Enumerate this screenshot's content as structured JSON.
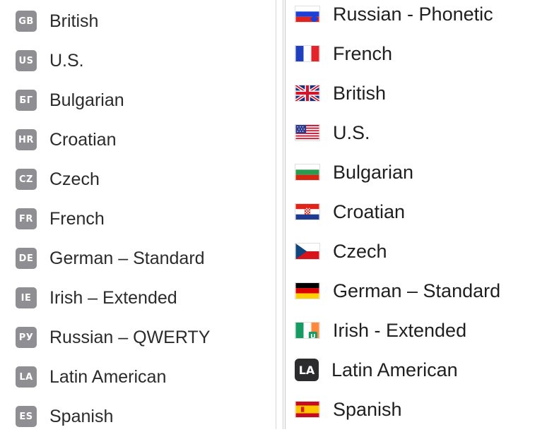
{
  "left_list": {
    "items": [
      {
        "badge": "GB",
        "label": "British"
      },
      {
        "badge": "US",
        "label": "U.S."
      },
      {
        "badge": "БГ",
        "label": "Bulgarian"
      },
      {
        "badge": "HR",
        "label": "Croatian"
      },
      {
        "badge": "CZ",
        "label": "Czech"
      },
      {
        "badge": "FR",
        "label": "French"
      },
      {
        "badge": "DE",
        "label": "German – Standard"
      },
      {
        "badge": "IE",
        "label": "Irish – Extended"
      },
      {
        "badge": "РУ",
        "label": "Russian – QWERTY"
      },
      {
        "badge": "LA",
        "label": "Latin American"
      },
      {
        "badge": "ES",
        "label": "Spanish"
      }
    ]
  },
  "right_list": {
    "items": [
      {
        "icon": "russia-flag-icon",
        "label": "Russian - Phonetic"
      },
      {
        "icon": "france-flag-icon",
        "label": "French"
      },
      {
        "icon": "uk-flag-icon",
        "label": "British"
      },
      {
        "icon": "us-flag-icon",
        "label": "U.S."
      },
      {
        "icon": "bulgaria-flag-icon",
        "label": "Bulgarian"
      },
      {
        "icon": "croatia-flag-icon",
        "label": "Croatian"
      },
      {
        "icon": "czech-flag-icon",
        "label": "Czech"
      },
      {
        "icon": "germany-flag-icon",
        "label": "German – Standard"
      },
      {
        "icon": "ireland-flag-icon",
        "label": "Irish - Extended"
      },
      {
        "icon": "la-badge-icon",
        "badge": "LA",
        "label": "Latin American"
      },
      {
        "icon": "spain-flag-icon",
        "label": "Spanish"
      }
    ]
  },
  "colors": {
    "badge_gray": "#8e8e93",
    "dark_badge": "#2c2c2e",
    "text": "#1d1d1f"
  }
}
